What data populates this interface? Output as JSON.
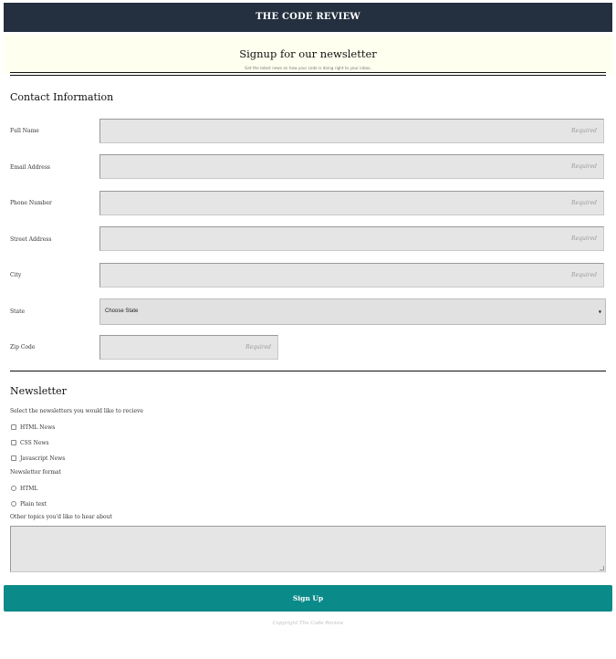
{
  "header": {
    "title": "THE CODE REVIEW"
  },
  "hero": {
    "title": "Signup for our newsletter",
    "subtitle": "Get the latest news on how your code is doing right to your inbox."
  },
  "contact": {
    "heading": "Contact Information",
    "fields": [
      {
        "label": "Full Name",
        "placeholder": "Required",
        "value": ""
      },
      {
        "label": "Email Address",
        "placeholder": "Required",
        "value": ""
      },
      {
        "label": "Phone Number",
        "placeholder": "Required",
        "value": ""
      },
      {
        "label": "Street Address",
        "placeholder": "Required",
        "value": ""
      },
      {
        "label": "City",
        "placeholder": "Required",
        "value": ""
      }
    ],
    "state": {
      "label": "State",
      "selected": "Choose State"
    },
    "zip": {
      "label": "Zip Code",
      "placeholder": "Required",
      "value": ""
    }
  },
  "newsletter": {
    "heading": "Newsletter",
    "select_prompt": "Select the newsletters you would like to recieve",
    "options": [
      {
        "label": "HTML News",
        "checked": false
      },
      {
        "label": "CSS News",
        "checked": false
      },
      {
        "label": "Javascript News",
        "checked": false
      }
    ],
    "format_label": "Newsletter format",
    "formats": [
      {
        "label": "HTML",
        "selected": false
      },
      {
        "label": "Plain text",
        "selected": false
      }
    ],
    "topics_label": "Other topics you'd like to hear about",
    "topics_value": ""
  },
  "submit": {
    "label": "Sign Up"
  },
  "footer": {
    "text": "Copyright The Code Review"
  },
  "colors": {
    "header_bg": "#243040",
    "hero_bg": "#fffff0",
    "button_bg": "#0a8a88",
    "input_bg": "#e5e5e5"
  }
}
